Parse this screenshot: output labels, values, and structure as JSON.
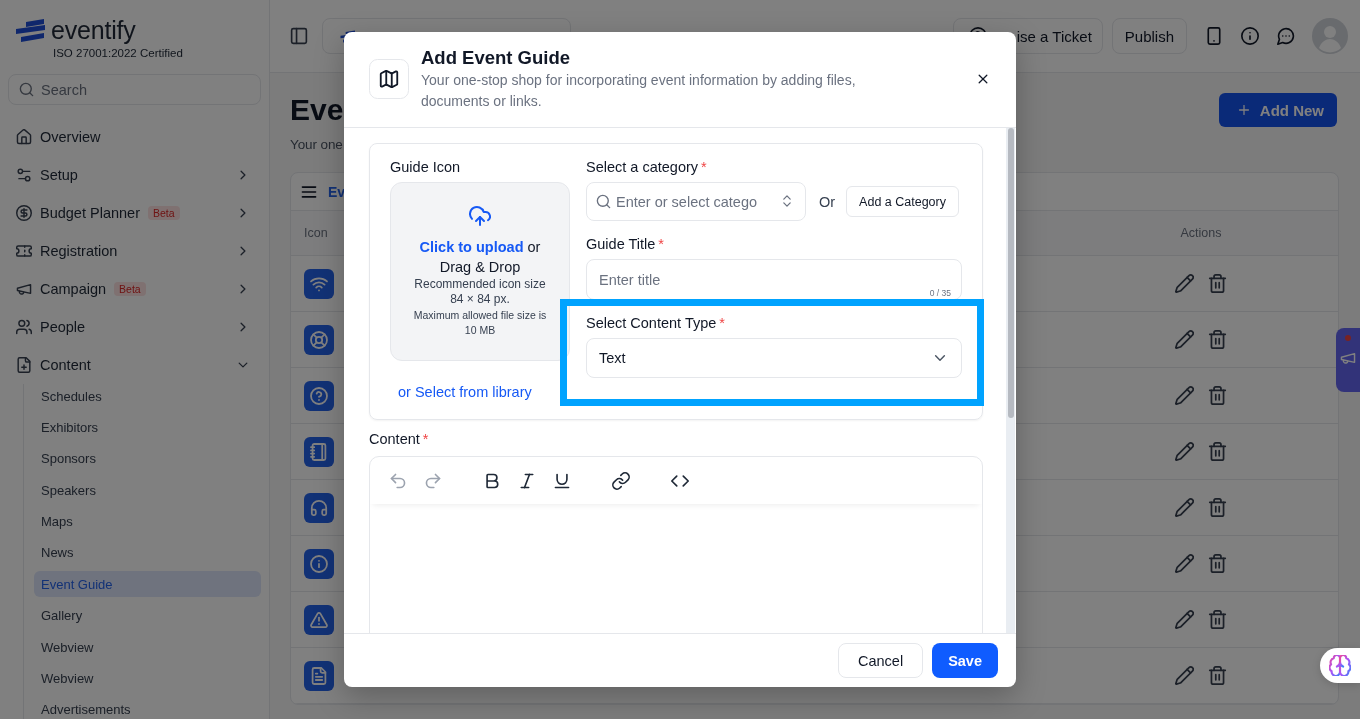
{
  "sidebar": {
    "brand": "eventify",
    "certification": "ISO 27001:2022 Certified",
    "search": {
      "placeholder": "Search"
    },
    "items": [
      {
        "label": "Overview",
        "kind": "link"
      },
      {
        "label": "Setup",
        "kind": "group",
        "expanded": false
      },
      {
        "label": "Budget Planner",
        "kind": "group",
        "expanded": false,
        "badge": "Beta"
      },
      {
        "label": "Registration",
        "kind": "group",
        "expanded": false
      },
      {
        "label": "Campaign",
        "kind": "group",
        "expanded": false,
        "badge": "Beta"
      },
      {
        "label": "People",
        "kind": "group",
        "expanded": false
      },
      {
        "label": "Content",
        "kind": "group",
        "expanded": true,
        "children": [
          {
            "label": "Schedules",
            "selected": false
          },
          {
            "label": "Exhibitors",
            "selected": false
          },
          {
            "label": "Sponsors",
            "selected": false
          },
          {
            "label": "Speakers",
            "selected": false
          },
          {
            "label": "Maps",
            "selected": false
          },
          {
            "label": "News",
            "selected": false
          },
          {
            "label": "Event Guide",
            "selected": true
          },
          {
            "label": "Gallery",
            "selected": false
          },
          {
            "label": "Webview",
            "selected": false
          },
          {
            "label": "Webview",
            "selected": false
          },
          {
            "label": "Advertisements",
            "selected": false
          }
        ]
      }
    ]
  },
  "topbar": {
    "buttons": [
      {
        "label": "ise a Ticket"
      },
      {
        "label": "Publish"
      }
    ]
  },
  "page": {
    "title": "Eve",
    "subtitle": "Your one",
    "add_button": "Add New",
    "table": {
      "title": "Ev",
      "columns": [
        "Icon",
        "Actions"
      ]
    }
  },
  "modal": {
    "title": "Add Event Guide",
    "description": "Your one-stop shop for incorporating event information by adding files, documents or links.",
    "guide_icon": {
      "label": "Guide Icon",
      "upload_link": "Click to upload",
      "upload_text": "or Drag & Drop",
      "size_hint": "Recommended icon size 84 × 84 px.",
      "file_hint": "Maximum allowed file size is 10 MB",
      "library_link": "or Select from library"
    },
    "fields": [
      {
        "kind": "combobox",
        "label": "Select a category",
        "required_mark": "*",
        "placeholder": "Enter or select catego",
        "or_text": "Or",
        "add_button": "Add a Category",
        "highlighted": false
      },
      {
        "kind": "text",
        "label": "Guide Title",
        "required_mark": "*",
        "placeholder": "Enter title",
        "counter": "0 / 35",
        "highlighted": false
      },
      {
        "kind": "select",
        "label": "Select Content Type",
        "required_mark": "*",
        "value": "Text",
        "highlighted": true
      }
    ],
    "content": {
      "label": "Content",
      "required_mark": "*",
      "toolbar": [
        {
          "disabled": true
        },
        {
          "disabled": true
        },
        {
          "disabled": false
        },
        {
          "disabled": false
        },
        {
          "disabled": false
        },
        {
          "disabled": false
        },
        {
          "disabled": false
        }
      ]
    },
    "footer": {
      "cancel": "Cancel",
      "save": "Save"
    }
  },
  "feedback_tab": {
    "unread": true
  }
}
